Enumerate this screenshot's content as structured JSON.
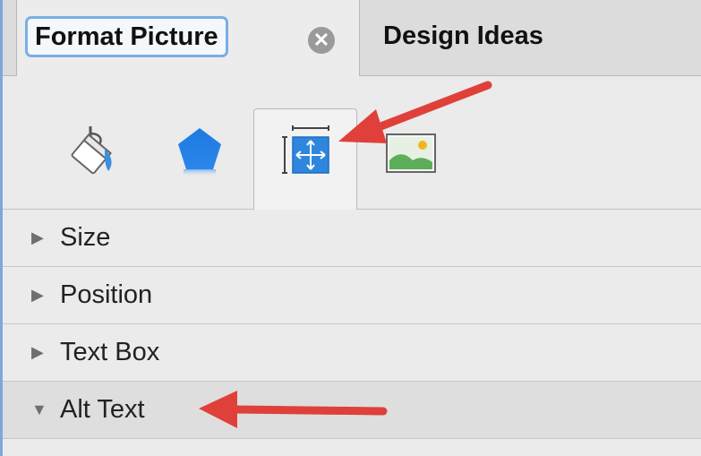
{
  "tabs": {
    "active_label": "Format Picture",
    "close_symbol": "✕",
    "other_label": "Design Ideas"
  },
  "toolbar": {
    "icons": [
      "fill-and-line-icon",
      "effects-icon",
      "size-and-properties-icon",
      "picture-icon"
    ],
    "selected": "size-and-properties-icon"
  },
  "sections": [
    {
      "label": "Size",
      "marker": "▶"
    },
    {
      "label": "Position",
      "marker": "▶"
    },
    {
      "label": "Text Box",
      "marker": "▶"
    },
    {
      "label": "Alt Text",
      "marker": "▼"
    }
  ],
  "colors": {
    "accent": "#3b8fe0",
    "annotation_arrow": "#e0403a",
    "focus_ring": "#7aaee6"
  }
}
